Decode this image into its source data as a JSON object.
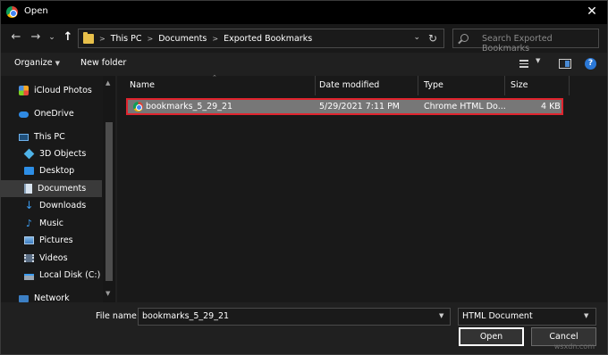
{
  "window": {
    "title": "Open",
    "close_glyph": "✕"
  },
  "nav_buttons": {
    "back": "←",
    "forward": "→",
    "dropdown": "⌄",
    "up": "↑"
  },
  "breadcrumb": {
    "segments": [
      "This PC",
      "Documents",
      "Exported Bookmarks"
    ]
  },
  "search": {
    "placeholder": "Search Exported Bookmarks"
  },
  "toolbar": {
    "organize_label": "Organize",
    "new_folder_label": "New folder",
    "help_glyph": "?"
  },
  "sidebar": {
    "items": [
      {
        "label": "iCloud Photos",
        "icon": "icloud-photos-icon"
      },
      {
        "label": "OneDrive",
        "icon": "onedrive-icon"
      },
      {
        "label": "This PC",
        "icon": "this-pc-icon"
      },
      {
        "label": "3D Objects",
        "icon": "3d-objects-icon"
      },
      {
        "label": "Desktop",
        "icon": "desktop-icon"
      },
      {
        "label": "Documents",
        "icon": "documents-icon",
        "selected": true
      },
      {
        "label": "Downloads",
        "icon": "downloads-icon"
      },
      {
        "label": "Music",
        "icon": "music-icon"
      },
      {
        "label": "Pictures",
        "icon": "pictures-icon"
      },
      {
        "label": "Videos",
        "icon": "videos-icon"
      },
      {
        "label": "Local Disk (C:)",
        "icon": "local-disk-icon"
      },
      {
        "label": "Network",
        "icon": "network-icon"
      }
    ]
  },
  "columns": {
    "name": "Name",
    "date_modified": "Date modified",
    "type": "Type",
    "size": "Size"
  },
  "files": [
    {
      "name": "bookmarks_5_29_21",
      "date_modified": "5/29/2021 7:11 PM",
      "type": "Chrome HTML Do...",
      "size": "4 KB",
      "selected": true
    }
  ],
  "footer": {
    "file_name_label": "File name:",
    "file_name_value": "bookmarks_5_29_21",
    "file_type_value": "HTML Document",
    "open_label": "Open",
    "cancel_label": "Cancel",
    "watermark": "wsxdn.com"
  },
  "colors": {
    "selection_border": "#e0242e",
    "selected_row": "#777777",
    "accent": "#2b78d6"
  }
}
